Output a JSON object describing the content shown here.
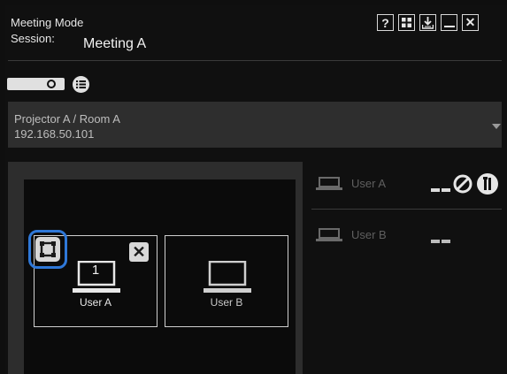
{
  "header": {
    "mode_title": "Meeting Mode",
    "session_label": "Session:",
    "session_name": "Meeting A",
    "buttons": [
      {
        "name": "help",
        "glyph": "?"
      },
      {
        "name": "grid",
        "glyph": ""
      },
      {
        "name": "download",
        "glyph": ""
      },
      {
        "name": "minimize",
        "glyph": ""
      },
      {
        "name": "close",
        "glyph": "✕"
      }
    ]
  },
  "projector": {
    "name": "Projector A / Room A",
    "ip": "192.168.50.101"
  },
  "layout": {
    "slots": [
      {
        "label": "User A",
        "number": "1"
      },
      {
        "label": "User B",
        "number": ""
      }
    ]
  },
  "users": [
    {
      "name": "User A"
    },
    {
      "name": "User B"
    }
  ],
  "colors": {
    "accent": "#2f78d8",
    "panel": "#2d2d2d",
    "background": "#101010"
  }
}
